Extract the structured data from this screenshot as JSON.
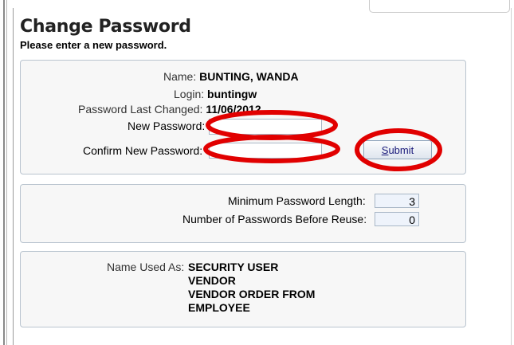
{
  "page": {
    "title": "Change Password",
    "subtitle": "Please enter a new password."
  },
  "user_info": {
    "name_label": "Name:",
    "name_value": "BUNTING, WANDA",
    "login_label": "Login:",
    "login_value": "buntingw",
    "last_changed_label": "Password Last Changed:",
    "last_changed_value": "11/06/2012",
    "new_password_label": "New Password:",
    "new_password_value": "",
    "confirm_password_label": "Confirm New Password:",
    "confirm_password_value": "",
    "submit_mnemonic": "S",
    "submit_rest": "ubmit"
  },
  "policy": {
    "min_length_label": "Minimum Password Length:",
    "min_length_value": "3",
    "reuse_label": "Number of Passwords Before Reuse:",
    "reuse_value": "0"
  },
  "roles": {
    "label": "Name Used As:",
    "items": [
      "SECURITY USER",
      "VENDOR",
      "VENDOR ORDER FROM",
      "EMPLOYEE"
    ]
  },
  "annotations": {
    "ellipse_color": "#e10000"
  }
}
